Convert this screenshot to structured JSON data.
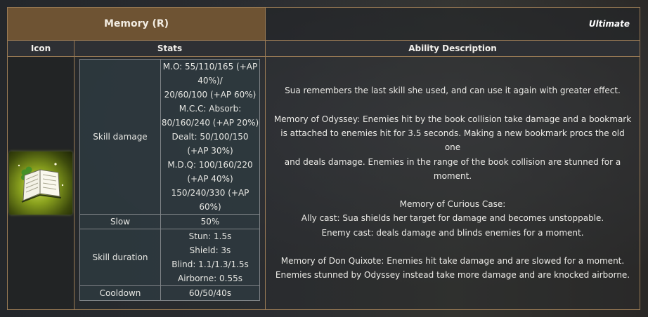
{
  "header": {
    "title": "Memory (R)",
    "tag": "Ultimate"
  },
  "columns": {
    "icon": "Icon",
    "stats": "Stats",
    "description": "Ability Description"
  },
  "icon": {
    "name": "open-book-icon",
    "accent": "#b6d23a"
  },
  "stats": {
    "skill_damage": {
      "label": "Skill damage",
      "lines": [
        "M.O: 55/110/165 (+AP",
        "40%)/",
        "20/60/100 (+AP 60%)",
        "M.C.C: Absorb:",
        "80/160/240 (+AP 20%)",
        "Dealt: 50/100/150",
        "(+AP 30%)",
        "M.D.Q: 100/160/220",
        "(+AP 40%)",
        "150/240/330 (+AP",
        "60%)"
      ]
    },
    "slow": {
      "label": "Slow",
      "value": "50%"
    },
    "skill_duration": {
      "label": "Skill duration",
      "lines": [
        "Stun: 1.5s",
        "Shield: 3s",
        "Blind: 1.1/1.3/1.5s",
        "Airborne: 0.55s"
      ]
    },
    "cooldown": {
      "label": "Cooldown",
      "value": "60/50/40s"
    }
  },
  "description": {
    "intro": "Sua remembers the last skill she used, and can use it again with greater effect.",
    "odyssey": [
      "Memory of Odyssey: Enemies hit by the book collision take damage and a bookmark",
      "is attached to enemies hit for 3.5 seconds. Making a new bookmark procs the old one",
      "and deals damage. Enemies in the range of the book collision are stunned for a",
      "moment."
    ],
    "curious": [
      "Memory of Curious Case:",
      "Ally cast: Sua shields her target for damage and becomes unstoppable.",
      "Enemy cast: deals damage and blinds enemies for a moment."
    ],
    "quixote": [
      "Memory of Don Quixote: Enemies hit take damage and are slowed for a moment.",
      "Enemies stunned by Odyssey instead take more damage and are knocked airborne."
    ]
  }
}
